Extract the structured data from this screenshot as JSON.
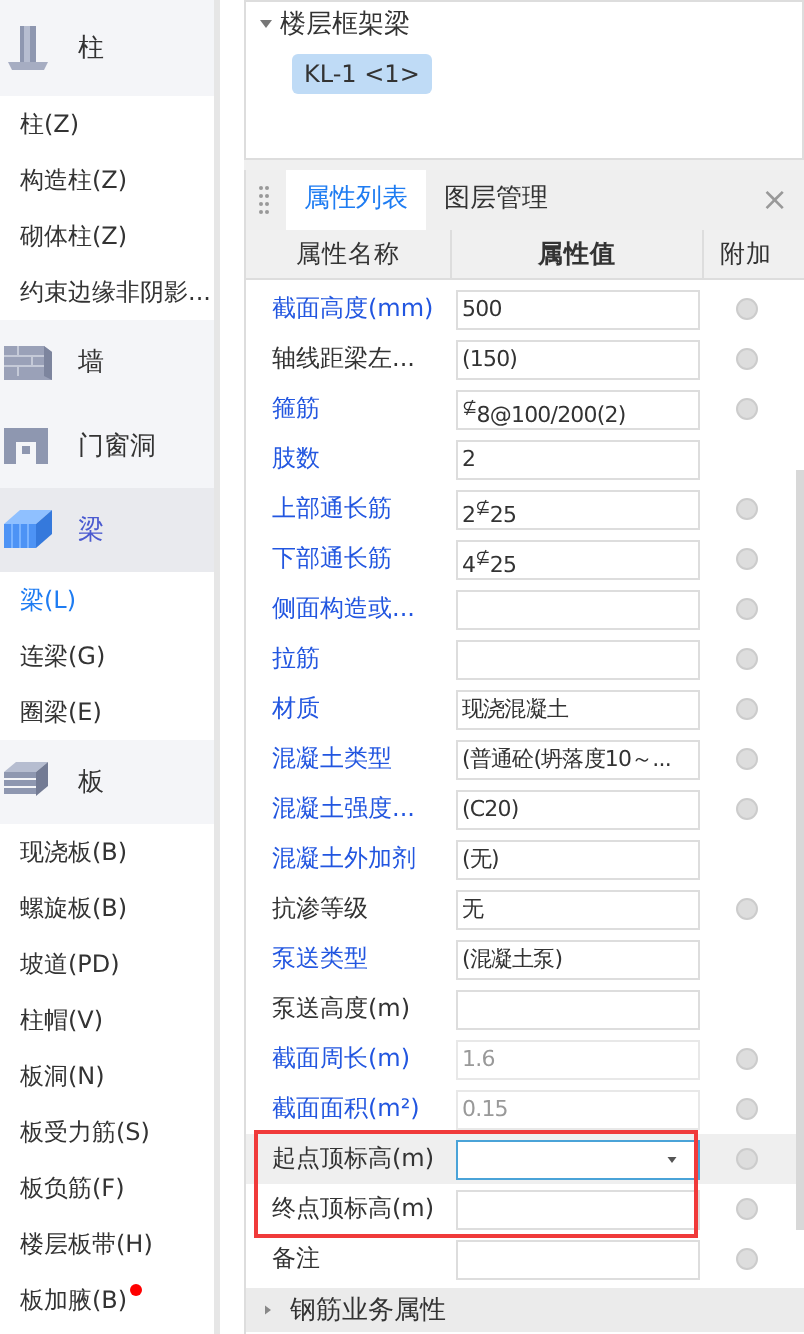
{
  "sidebar": {
    "categories": [
      {
        "label": "柱",
        "kind": "column",
        "selected": false,
        "items": [
          {
            "label": "柱(Z)",
            "selected": false,
            "badge": false
          },
          {
            "label": "构造柱(Z)",
            "selected": false,
            "badge": false
          },
          {
            "label": "砌体柱(Z)",
            "selected": false,
            "badge": false
          },
          {
            "label": "约束边缘非阴影...",
            "selected": false,
            "badge": false
          }
        ]
      },
      {
        "label": "墙",
        "kind": "wall",
        "selected": false
      },
      {
        "label": "门窗洞",
        "kind": "opening",
        "selected": false
      },
      {
        "label": "梁",
        "kind": "beam",
        "selected": true,
        "items": [
          {
            "label": "梁(L)",
            "selected": true,
            "badge": false
          },
          {
            "label": "连梁(G)",
            "selected": false,
            "badge": false
          },
          {
            "label": "圈梁(E)",
            "selected": false,
            "badge": false
          }
        ]
      },
      {
        "label": "板",
        "kind": "slab",
        "selected": false,
        "items": [
          {
            "label": "现浇板(B)",
            "selected": false,
            "badge": false
          },
          {
            "label": "螺旋板(B)",
            "selected": false,
            "badge": false
          },
          {
            "label": "坡道(PD)",
            "selected": false,
            "badge": false
          },
          {
            "label": "柱帽(V)",
            "selected": false,
            "badge": false
          },
          {
            "label": "板洞(N)",
            "selected": false,
            "badge": false
          },
          {
            "label": "板受力筋(S)",
            "selected": false,
            "badge": false
          },
          {
            "label": "板负筋(F)",
            "selected": false,
            "badge": false
          },
          {
            "label": "楼层板带(H)",
            "selected": false,
            "badge": false
          },
          {
            "label": "板加腋(B)",
            "selected": false,
            "badge": true
          }
        ]
      }
    ]
  },
  "tree": {
    "group": "楼层框架梁",
    "expanded": true,
    "items": [
      {
        "label": "KL-1 <1>",
        "selected": true
      }
    ]
  },
  "panel": {
    "tabs": [
      {
        "label": "属性列表",
        "selected": true
      },
      {
        "label": "图层管理",
        "selected": false
      }
    ],
    "close": "×",
    "columns": [
      "属性名称",
      "属性值",
      "附加"
    ],
    "rows": [
      {
        "name": "截面高度(mm)",
        "value": "500",
        "kind": "text",
        "link": true,
        "attach": true,
        "selected": false,
        "highlighted": false
      },
      {
        "name": "轴线距梁左...",
        "value": "(150)",
        "kind": "text",
        "link": false,
        "attach": true,
        "selected": false,
        "highlighted": false
      },
      {
        "name": "箍筋",
        "value": "$^{⊈}$8@100/200(2)",
        "kind": "text",
        "link": true,
        "attach": true,
        "selected": false,
        "highlighted": false
      },
      {
        "name": "肢数",
        "value": "2",
        "kind": "text",
        "link": true,
        "attach": false,
        "selected": false,
        "highlighted": false
      },
      {
        "name": "上部通长筋",
        "value": "2$^{⊈}$25",
        "kind": "text",
        "link": true,
        "attach": true,
        "selected": false,
        "highlighted": false
      },
      {
        "name": "下部通长筋",
        "value": "4$^{⊈}$25",
        "kind": "text",
        "link": true,
        "attach": true,
        "selected": false,
        "highlighted": false
      },
      {
        "name": "侧面构造或...",
        "kind": "text",
        "link": true,
        "attach": true,
        "selected": false,
        "highlighted": false
      },
      {
        "name": "拉筋",
        "kind": "text",
        "link": true,
        "attach": true,
        "selected": false,
        "highlighted": false
      },
      {
        "name": "材质",
        "value": "现浇混凝土",
        "kind": "text",
        "link": true,
        "attach": true,
        "selected": false,
        "highlighted": false
      },
      {
        "name": "混凝土类型",
        "value": "(普通砼(坍落度10～...",
        "kind": "text",
        "link": true,
        "attach": true,
        "selected": false,
        "highlighted": false
      },
      {
        "name": "混凝土强度...",
        "value": "(C20)",
        "kind": "text",
        "link": true,
        "attach": true,
        "selected": false,
        "highlighted": false
      },
      {
        "name": "混凝土外加剂",
        "value": "(无)",
        "kind": "text",
        "link": true,
        "attach": false,
        "selected": false,
        "highlighted": false
      },
      {
        "name": "抗渗等级",
        "value": "无",
        "kind": "text",
        "link": false,
        "attach": true,
        "selected": false,
        "highlighted": false
      },
      {
        "name": "泵送类型",
        "value": "(混凝土泵)",
        "kind": "text",
        "link": true,
        "attach": false,
        "selected": false,
        "highlighted": false
      },
      {
        "name": "泵送高度(m)",
        "kind": "text",
        "link": false,
        "attach": false,
        "selected": false,
        "highlighted": false
      },
      {
        "name": "截面周长(m)",
        "value": "1.6",
        "kind": "text",
        "link": true,
        "disabled": true,
        "attach": true,
        "selected": false,
        "highlighted": false
      },
      {
        "name": "截面面积(m²)",
        "value": "0.15",
        "kind": "text",
        "link": true,
        "disabled": true,
        "attach": true,
        "selected": false,
        "highlighted": false
      },
      {
        "name": "起点顶标高(m)",
        "kind": "dropdown",
        "link": false,
        "attach": true,
        "selected": true,
        "highlighted": true
      },
      {
        "name": "终点顶标高(m)",
        "kind": "text",
        "link": false,
        "attach": true,
        "selected": false,
        "highlighted": true
      },
      {
        "name": "备注",
        "kind": "text",
        "link": false,
        "attach": true,
        "selected": false,
        "highlighted": false
      }
    ],
    "section": {
      "label": "钢筋业务属性",
      "expanded": false
    }
  }
}
